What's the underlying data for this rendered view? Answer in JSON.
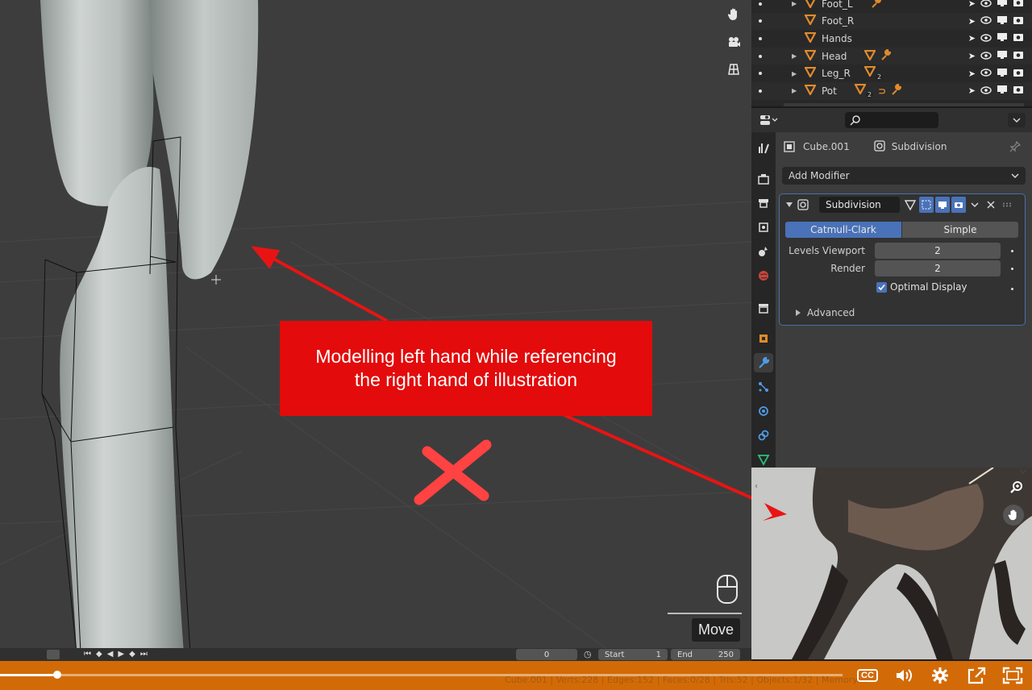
{
  "outliner": {
    "rows": [
      {
        "name": "Foot_L",
        "expand": true
      },
      {
        "name": "Foot_R",
        "expand": false
      },
      {
        "name": "Hands",
        "expand": false
      },
      {
        "name": "Head",
        "expand": true
      },
      {
        "name": "Leg_R",
        "expand": true,
        "badge": "2"
      },
      {
        "name": "Pot",
        "expand": true,
        "badge": "2"
      }
    ]
  },
  "properties": {
    "object_name": "Cube.001",
    "modifier_context": "Subdivision",
    "add_modifier": "Add Modifier",
    "modifier": {
      "name": "Subdivision",
      "mode_catmull": "Catmull-Clark",
      "mode_simple": "Simple",
      "levels_viewport_label": "Levels Viewport",
      "levels_viewport": "2",
      "render_label": "Render",
      "render": "2",
      "optimal_display": "Optimal Display",
      "advanced": "Advanced"
    }
  },
  "viewport": {
    "move_label": "Move"
  },
  "timeline": {
    "current_frame": "0",
    "start_label": "Start",
    "start": "1",
    "end_label": "End",
    "end": "250"
  },
  "statusbar": {
    "text": "Cube.001 | Verts:228 | Edges:152 | Faces:0/28 | Tris:52 | Objects:1/32 | Memory:..."
  },
  "annotation": {
    "line1": "Modelling left hand while referencing",
    "line2": "the right hand of illustration"
  },
  "player": {
    "progress": 0.068,
    "cc_label": "CC"
  },
  "colors": {
    "accent": "#d26b07",
    "callout": "#e30b0b",
    "selection_blue": "#4a72b8",
    "mesh_orange": "#e08a2c"
  }
}
